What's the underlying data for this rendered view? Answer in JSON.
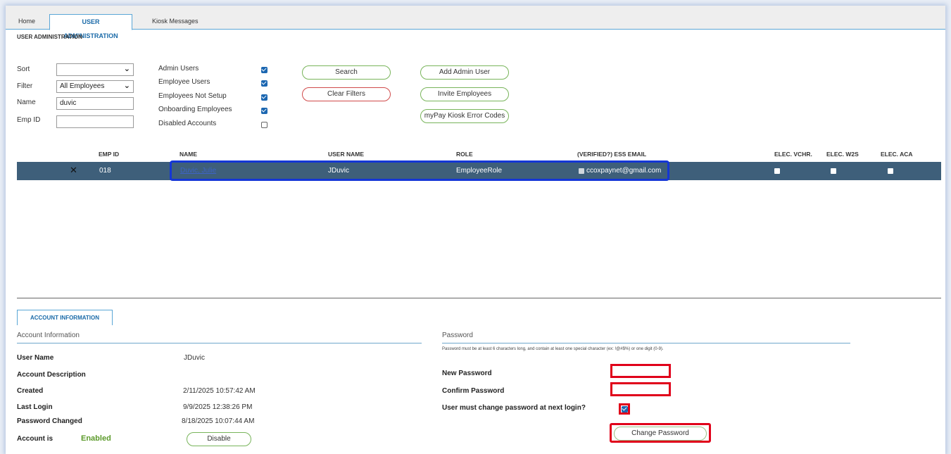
{
  "tabs": [
    {
      "label": "Home"
    },
    {
      "label": "USER ADMINISTRATION"
    },
    {
      "label": "Kiosk Messages"
    }
  ],
  "page_title": "USER ADMINISTRATION",
  "filters": {
    "sort_label": "Sort",
    "sort_value": "",
    "filter_label": "Filter",
    "filter_value": "All Employees",
    "name_label": "Name",
    "name_value": "duvic",
    "empid_label": "Emp ID",
    "empid_value": ""
  },
  "checkboxes": [
    {
      "label": "Admin Users",
      "checked": true
    },
    {
      "label": "Employee Users",
      "checked": true
    },
    {
      "label": "Employees Not Setup",
      "checked": true
    },
    {
      "label": "Onboarding Employees",
      "checked": true
    },
    {
      "label": "Disabled Accounts",
      "checked": false
    }
  ],
  "buttons": {
    "search": "Search",
    "clear_filters": "Clear Filters",
    "add_admin_user": "Add Admin User",
    "invite_employees": "Invite Employees",
    "kiosk_error_codes": "myPay Kiosk Error Codes"
  },
  "table": {
    "headers": {
      "emp_id": "EMP ID",
      "name": "NAME",
      "user_name": "USER NAME",
      "role": "ROLE",
      "email": "(VERIFIED?) ESS EMAIL",
      "elec_vchr": "ELEC. VCHR.",
      "elec_w2s": "ELEC. W2S",
      "elec_aca": "ELEC. ACA"
    },
    "rows": [
      {
        "emp_id": "018",
        "name": "Duvic, Julie",
        "user_name": "JDuvic",
        "role": "EmployeeRole",
        "email": "ccoxpaynet@gmail.com"
      }
    ]
  },
  "account": {
    "tab_label": "ACCOUNT INFORMATION",
    "section_header": "Account Information",
    "user_name_label": "User Name",
    "user_name_value": "JDuvic",
    "description_label": "Account Description",
    "created_label": "Created",
    "created_value": "2/11/2025 10:57:42 AM",
    "last_login_label": "Last Login",
    "last_login_value": "9/9/2025 12:38:26 PM",
    "pw_changed_label": "Password Changed",
    "pw_changed_value": "8/18/2025 10:07:44 AM",
    "account_is_label": "Account is",
    "status_value": "Enabled",
    "disable_button": "Disable"
  },
  "password": {
    "section_header": "Password",
    "requirements": "Password must be at least 6 characters long, and contain at least one special character (ex: !@#$%) or one digit (0-9).",
    "new_label": "New Password",
    "confirm_label": "Confirm Password",
    "must_change_label": "User must change password at next login?",
    "change_button": "Change Password"
  },
  "colors": {
    "row_bg": "#3e5f7a",
    "highlight_blue": "#1436d6",
    "highlight_red": "#e0001a",
    "enabled_green": "#5b9a2a",
    "tab_blue": "#1a6aa8"
  }
}
